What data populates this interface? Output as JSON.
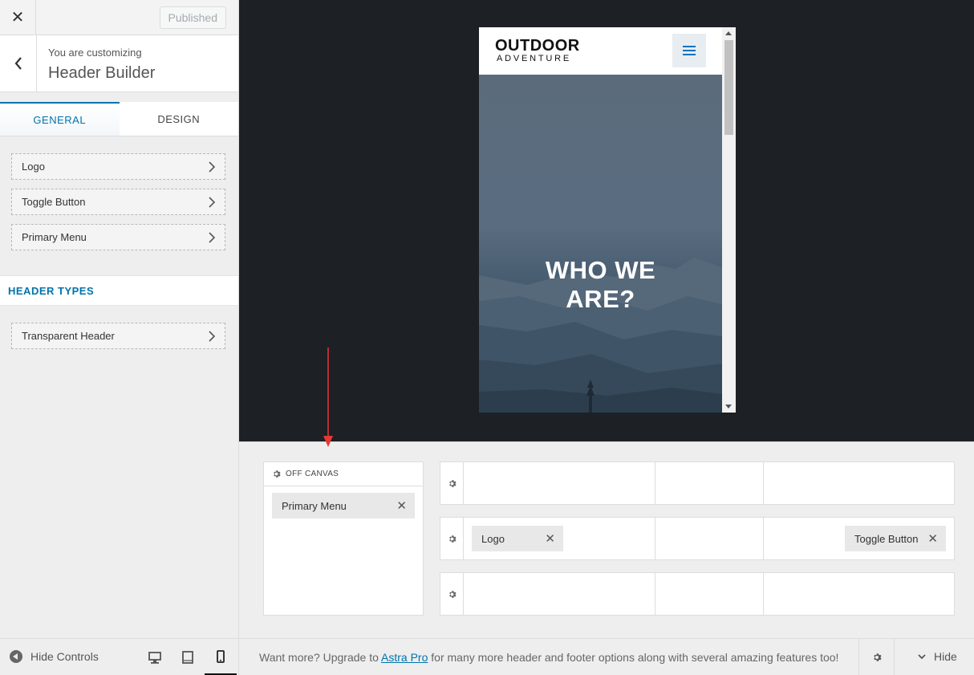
{
  "sidebar": {
    "close_icon": "close-icon",
    "publish_label": "Published",
    "customizing_label": "You are customizing",
    "section_title": "Header Builder",
    "tabs": [
      {
        "label": "GENERAL",
        "active": true
      },
      {
        "label": "DESIGN",
        "active": false
      }
    ],
    "items": [
      {
        "label": "Logo"
      },
      {
        "label": "Toggle Button"
      },
      {
        "label": "Primary Menu"
      }
    ],
    "header_types_label": "HEADER TYPES",
    "header_type_items": [
      {
        "label": "Transparent Header"
      }
    ]
  },
  "preview": {
    "logo_main": "OUTDOOR",
    "logo_sub": "ADVENTURE",
    "hero_title_line1": "WHO WE",
    "hero_title_line2": "ARE?"
  },
  "builder": {
    "off_canvas_label": "OFF CANVAS",
    "off_canvas_items": [
      "Primary Menu"
    ],
    "rows": [
      {
        "left": [],
        "center": [],
        "right": []
      },
      {
        "left": [
          "Logo"
        ],
        "center": [],
        "right": [
          "Toggle Button"
        ]
      },
      {
        "left": [],
        "center": [],
        "right": []
      }
    ],
    "remove_glyph": "✕"
  },
  "footer": {
    "hide_controls_label": "Hide Controls",
    "devices": [
      "desktop",
      "tablet",
      "mobile"
    ],
    "active_device": "mobile",
    "upsell_prefix": "Want more? Upgrade to ",
    "upsell_link": "Astra Pro",
    "upsell_suffix": " for many more header and footer options along with several amazing features too!",
    "hide_label": "Hide"
  },
  "colors": {
    "accent": "#0073aa",
    "preview_bg": "#1d2024",
    "annotation_arrow": "#e53935"
  }
}
